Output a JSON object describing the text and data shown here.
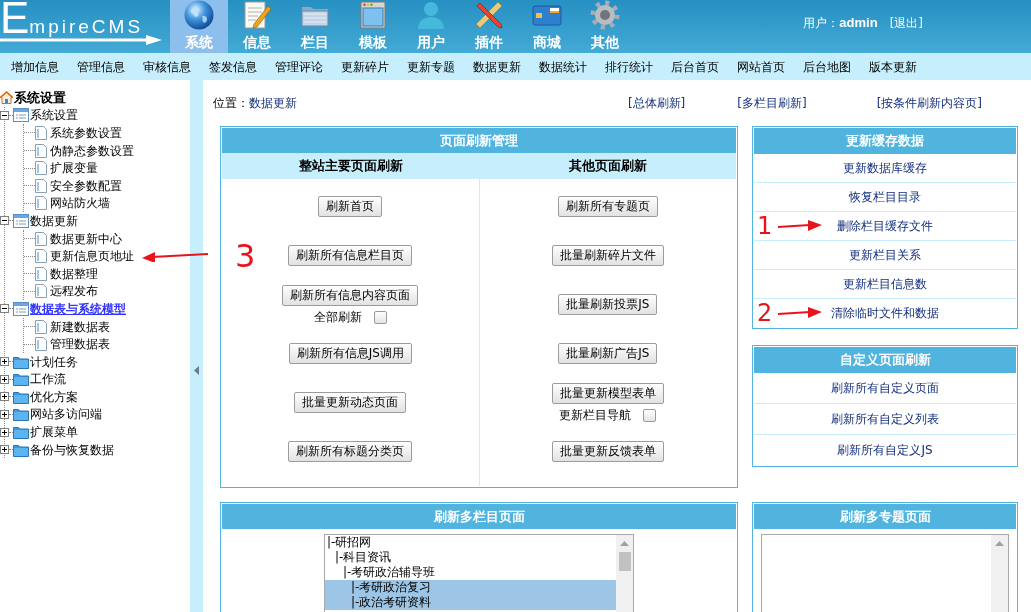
{
  "header": {
    "logo": "EmpireCMS",
    "nav": [
      {
        "label": "系统",
        "selected": true
      },
      {
        "label": "信息",
        "selected": false
      },
      {
        "label": "栏目",
        "selected": false
      },
      {
        "label": "模板",
        "selected": false
      },
      {
        "label": "用户",
        "selected": false
      },
      {
        "label": "插件",
        "selected": false
      },
      {
        "label": "商城",
        "selected": false
      },
      {
        "label": "其他",
        "selected": false
      }
    ],
    "user_label": "用户：",
    "user_name": "admin",
    "logout": "[退出]"
  },
  "menu": [
    "增加信息",
    "管理信息",
    "审核信息",
    "签发信息",
    "管理评论",
    "更新碎片",
    "更新专题",
    "数据更新",
    "数据统计",
    "排行统计",
    "后台首页",
    "网站首页",
    "后台地图",
    "版本更新"
  ],
  "sidebar": {
    "root": "系统设置",
    "groups": [
      {
        "label": "系统设置",
        "expanded": true,
        "selected": false,
        "children": [
          {
            "label": "系统参数设置"
          },
          {
            "label": "伪静态参数设置"
          },
          {
            "label": "扩展变量"
          },
          {
            "label": "安全参数配置"
          },
          {
            "label": "网站防火墙"
          }
        ]
      },
      {
        "label": "数据更新",
        "expanded": true,
        "selected": false,
        "children": [
          {
            "label": "数据更新中心"
          },
          {
            "label": "更新信息页地址",
            "annotation": "3"
          },
          {
            "label": "数据整理"
          },
          {
            "label": "远程发布"
          }
        ]
      },
      {
        "label": "数据表与系统模型",
        "expanded": true,
        "selected": true,
        "children": [
          {
            "label": "新建数据表"
          },
          {
            "label": "管理数据表"
          }
        ]
      },
      {
        "label": "计划任务",
        "expanded": false,
        "selected": false
      },
      {
        "label": "工作流",
        "expanded": false,
        "selected": false
      },
      {
        "label": "优化方案",
        "expanded": false,
        "selected": false
      },
      {
        "label": "网站多访问端",
        "expanded": false,
        "selected": false
      },
      {
        "label": "扩展菜单",
        "expanded": false,
        "selected": false
      },
      {
        "label": "备份与恢复数据",
        "expanded": false,
        "selected": false
      }
    ]
  },
  "breadcrumb": {
    "label": "位置：",
    "current": "数据更新"
  },
  "quick_links": [
    "[总体刷新]",
    "[多栏目刷新]",
    "[按条件刷新内容页]"
  ],
  "refresh_panel": {
    "title": "页面刷新管理",
    "columns": [
      {
        "heading": "整站主要页面刷新",
        "items": [
          {
            "label": "刷新首页"
          },
          {
            "label": "刷新所有信息栏目页"
          },
          {
            "label": "刷新所有信息内容页面",
            "option": {
              "label": "全部刷新",
              "checked": false
            }
          },
          {
            "label": "刷新所有信息JS调用"
          },
          {
            "label": "批量更新动态页面"
          },
          {
            "label": "刷新所有标题分类页"
          }
        ]
      },
      {
        "heading": "其他页面刷新",
        "items": [
          {
            "label": "刷新所有专题页"
          },
          {
            "label": "批量刷新碎片文件"
          },
          {
            "label": "批量刷新投票JS"
          },
          {
            "label": "批量刷新广告JS"
          },
          {
            "label": "批量更新模型表单",
            "option": {
              "label": "更新栏目导航",
              "checked": false
            }
          },
          {
            "label": "批量更新反馈表单"
          }
        ]
      }
    ]
  },
  "cache_panel": {
    "title": "更新缓存数据",
    "items": [
      {
        "label": "更新数据库缓存"
      },
      {
        "label": "恢复栏目目录"
      },
      {
        "label": "删除栏目缓存文件",
        "annotation": "1"
      },
      {
        "label": "更新栏目关系"
      },
      {
        "label": "更新栏目信息数"
      },
      {
        "label": "清除临时文件和数据",
        "annotation": "2"
      }
    ]
  },
  "custom_panel": {
    "title": "自定义页面刷新",
    "items": [
      {
        "label": "刷新所有自定义页面"
      },
      {
        "label": "刷新所有自定义列表"
      },
      {
        "label": "刷新所有自定义JS"
      }
    ]
  },
  "multi_column_panel": {
    "title": "刷新多栏目页面",
    "options": [
      {
        "label": "|-研招网",
        "selected": false,
        "children": [
          {
            "label": "|-科目资讯",
            "selected": false,
            "children": [
              {
                "label": "|-考研政治辅导班",
                "selected": false,
                "children": [
                  {
                    "label": "|-考研政治复习",
                    "selected": true
                  },
                  {
                    "label": "|-政治考研资料",
                    "selected": true
                  }
                ]
              }
            ]
          }
        ]
      }
    ]
  },
  "multi_topic_panel": {
    "title": "刷新多专题页面"
  }
}
